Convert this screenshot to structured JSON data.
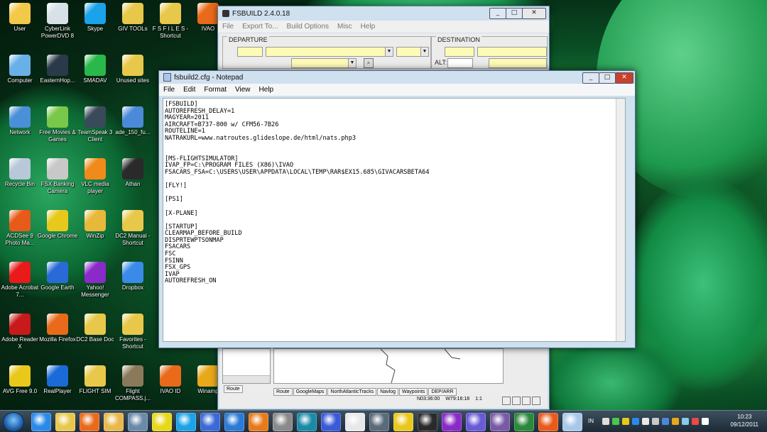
{
  "desktop_icons": [
    {
      "label": "User",
      "col": 0,
      "row": 0,
      "color": "#f3c94a"
    },
    {
      "label": "CyberLink PowerDVD 8",
      "col": 1,
      "row": 0,
      "color": "#d8e0e8"
    },
    {
      "label": "Skype",
      "col": 2,
      "row": 0,
      "color": "#1aa3e8"
    },
    {
      "label": "GIV TOOLs",
      "col": 3,
      "row": 0,
      "color": "#e8c84a"
    },
    {
      "label": "F S F I L E S - Shortcut",
      "col": 4,
      "row": 0,
      "color": "#e8c84a"
    },
    {
      "label": "IVAO",
      "col": 5,
      "row": 0,
      "color": "#e86a1a"
    },
    {
      "label": "Computer",
      "col": 0,
      "row": 1,
      "color": "#6ab0e8"
    },
    {
      "label": "EasternHop...",
      "col": 1,
      "row": 1,
      "color": "#2a3a4a"
    },
    {
      "label": "SMADAV",
      "col": 2,
      "row": 1,
      "color": "#2ab84a"
    },
    {
      "label": "Unused sites",
      "col": 3,
      "row": 1,
      "color": "#e8c84a"
    },
    {
      "label": "Network",
      "col": 0,
      "row": 2,
      "color": "#4a90d8"
    },
    {
      "label": "Free Movies & Games",
      "col": 1,
      "row": 2,
      "color": "#7ac84a"
    },
    {
      "label": "TeamSpeak 3 Client",
      "col": 2,
      "row": 2,
      "color": "#3a4a5a"
    },
    {
      "label": "ade_150_fu...",
      "col": 3,
      "row": 2,
      "color": "#4a8ad8"
    },
    {
      "label": "Recycle Bin",
      "col": 0,
      "row": 3,
      "color": "#b8c8d8"
    },
    {
      "label": "FSX Banking Camera",
      "col": 1,
      "row": 3,
      "color": "#c8c8c8"
    },
    {
      "label": "VLC media player",
      "col": 2,
      "row": 3,
      "color": "#f08a1a"
    },
    {
      "label": "Athan",
      "col": 3,
      "row": 3,
      "color": "#2a2a2a"
    },
    {
      "label": "ACDSee 9 Photo Ma...",
      "col": 0,
      "row": 4,
      "color": "#e85a1a"
    },
    {
      "label": "Google Chrome",
      "col": 1,
      "row": 4,
      "color": "#e8c81a"
    },
    {
      "label": "WinZip",
      "col": 2,
      "row": 4,
      "color": "#e8b83a"
    },
    {
      "label": "DC2 Manual - Shortcut",
      "col": 3,
      "row": 4,
      "color": "#e8c84a"
    },
    {
      "label": "Adobe Acrobat 7...",
      "col": 0,
      "row": 5,
      "color": "#e81a1a"
    },
    {
      "label": "Google Earth",
      "col": 1,
      "row": 5,
      "color": "#2a6ad8"
    },
    {
      "label": "Yahoo! Messenger",
      "col": 2,
      "row": 5,
      "color": "#8a2ac8"
    },
    {
      "label": "Dropbox",
      "col": 3,
      "row": 5,
      "color": "#3a8ae8"
    },
    {
      "label": "Adobe Reader X",
      "col": 0,
      "row": 6,
      "color": "#c81a1a"
    },
    {
      "label": "Mozilla Firefox",
      "col": 1,
      "row": 6,
      "color": "#e86a1a"
    },
    {
      "label": "DC2 Base Doc",
      "col": 2,
      "row": 6,
      "color": "#e8c84a"
    },
    {
      "label": "Favorites - Shortcut",
      "col": 3,
      "row": 6,
      "color": "#e8c84a"
    },
    {
      "label": "AVG Free 9.0",
      "col": 0,
      "row": 7,
      "color": "#e8c81a"
    },
    {
      "label": "RealPlayer",
      "col": 1,
      "row": 7,
      "color": "#1a6ad8"
    },
    {
      "label": "FLIGHT SIM",
      "col": 2,
      "row": 7,
      "color": "#e8c84a"
    },
    {
      "label": "Flight COMPASS.j...",
      "col": 3,
      "row": 7,
      "color": "#8a7a5a"
    },
    {
      "label": "IVAO ID",
      "col": 4,
      "row": 7,
      "color": "#e86a1a"
    },
    {
      "label": "Winamp",
      "col": 5,
      "row": 7,
      "color": "#e8a81a"
    }
  ],
  "fsbuild": {
    "title": "FSBUILD 2.4.0.18",
    "menu": [
      "File",
      "Export To...",
      "Build Options",
      "Misc",
      "Help"
    ],
    "departure_label": "DEPARTURE",
    "destination_label": "DESTINATION",
    "alt_label": "ALT:",
    "left_tab": "Route",
    "tabs": [
      "Route",
      "GoogleMaps",
      "NorthAtlanticTracks",
      "Navlog",
      "Waypoints",
      "DEP/ARR"
    ],
    "coord_lat": "N03:36:00",
    "coord_lon": "W79:16:18",
    "zoom": "1:1"
  },
  "notepad": {
    "title": "fsbuild2.cfg - Notepad",
    "menu": [
      "File",
      "Edit",
      "Format",
      "View",
      "Help"
    ],
    "content": "[FSBUILD]\nAUTOREFRESH_DELAY=1\nMAGYEAR=2011\nAIRCRAFT=B737-800 w/ CFM56-7B26\nROUTELINE=1\nNATRAKURL=www.natroutes.glideslope.de/html/nats.php3\n\n\n[MS-FLIGHTSIMULATOR]\nIVAP_FP=C:\\PROGRAM FILES (X86)\\IVAO\nFSACARS_FSA=C:\\USERS\\USER\\APPDATA\\LOCAL\\TEMP\\RAR$EX15.685\\GIVACARSBETA64\n\n[FLY!]\n\n[PS1]\n\n[X-PLANE]\n\n[STARTUP]\nCLEARMAP_BEFORE_BUILD\nDISPRTEWPTSONMAP\nFSACARS\nFSC\nFSINN\nFSX_GPS\nIVAP\nAUTOREFRESH_ON"
  },
  "taskbar": {
    "language": "IN",
    "time": "10:23",
    "date": "09/12/2011",
    "apps": [
      {
        "name": "internet-explorer",
        "color": "#2a8ae8"
      },
      {
        "name": "explorer",
        "color": "#e8c84a"
      },
      {
        "name": "firefox",
        "color": "#e86a1a"
      },
      {
        "name": "folder",
        "color": "#e8b84a"
      },
      {
        "name": "plane",
        "color": "#6a8aa8"
      },
      {
        "name": "airplane-yellow",
        "color": "#e8d81a"
      },
      {
        "name": "skype",
        "color": "#1aa3e8"
      },
      {
        "name": "fsx",
        "color": "#3a6ad8"
      },
      {
        "name": "ie-blue",
        "color": "#2a7ad8"
      },
      {
        "name": "media",
        "color": "#e87a1a"
      },
      {
        "name": "app",
        "color": "#8a8a8a"
      },
      {
        "name": "flight",
        "color": "#1a8aa8"
      },
      {
        "name": "network",
        "color": "#3a5ad8"
      },
      {
        "name": "fsx-pilot",
        "color": "#e8e8e8"
      },
      {
        "name": "teamspeak",
        "color": "#5a6a7a"
      },
      {
        "name": "chrome",
        "color": "#e8c81a"
      },
      {
        "name": "plane-2",
        "color": "#2a2a2a"
      },
      {
        "name": "yahoo",
        "color": "#8a2ac8"
      },
      {
        "name": "pidgin",
        "color": "#6a5ad8"
      },
      {
        "name": "ts",
        "color": "#7a5aa8"
      },
      {
        "name": "excel",
        "color": "#2a8a3a"
      },
      {
        "name": "acdsee",
        "color": "#e85a1a"
      },
      {
        "name": "notepad",
        "color": "#a8c8e8"
      }
    ]
  }
}
